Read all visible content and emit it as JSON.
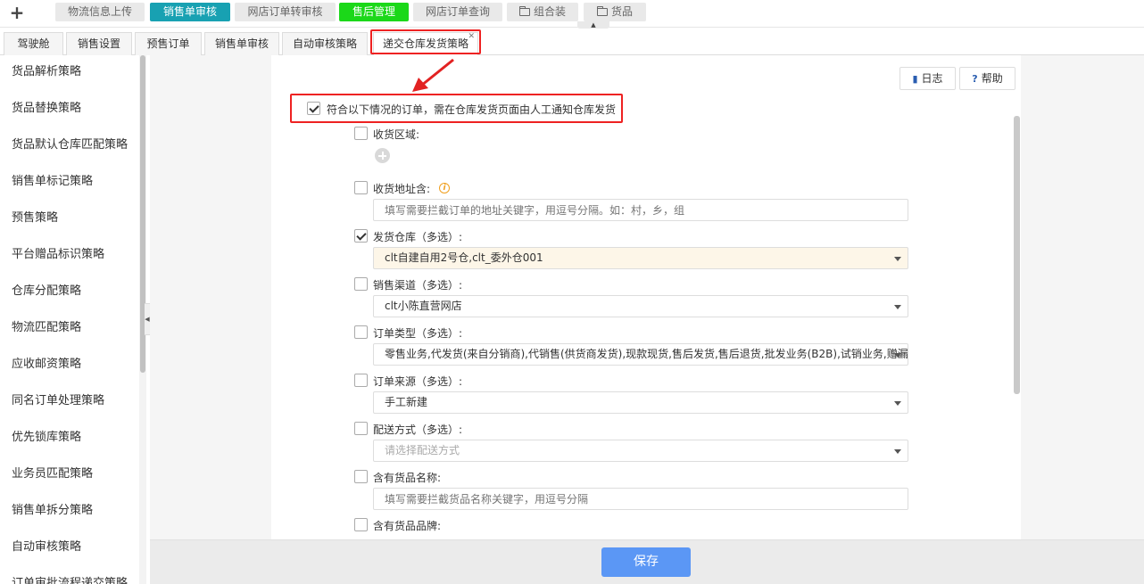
{
  "top_tabs": [
    {
      "label": "物流信息上传"
    },
    {
      "label": "销售单审核"
    },
    {
      "label": "网店订单转审核"
    },
    {
      "label": "售后管理"
    },
    {
      "label": "网店订单查询"
    },
    {
      "label": "组合装"
    },
    {
      "label": "货品"
    }
  ],
  "colors": {
    "active_teal": "#18a1b2",
    "green_tab": "#1bd819",
    "save_blue": "#5b97f5",
    "annotation_red": "#e22222"
  },
  "sub_tabs": [
    {
      "label": "驾驶舱"
    },
    {
      "label": "销售设置"
    },
    {
      "label": "预售订单"
    },
    {
      "label": "销售单审核"
    },
    {
      "label": "自动审核策略"
    },
    {
      "label": "递交仓库发货策略"
    }
  ],
  "sidebar": {
    "items": [
      {
        "label": "货品解析策略"
      },
      {
        "label": "货品替换策略"
      },
      {
        "label": "货品默认仓库匹配策略"
      },
      {
        "label": "销售单标记策略"
      },
      {
        "label": "预售策略"
      },
      {
        "label": "平台赠品标识策略"
      },
      {
        "label": "仓库分配策略"
      },
      {
        "label": "物流匹配策略"
      },
      {
        "label": "应收邮资策略"
      },
      {
        "label": "同名订单处理策略"
      },
      {
        "label": "优先锁库策略"
      },
      {
        "label": "业务员匹配策略"
      },
      {
        "label": "销售单拆分策略"
      },
      {
        "label": "自动审核策略"
      },
      {
        "label": "订单审批流程递交策略"
      }
    ]
  },
  "toolbar": {
    "log_label": "日志",
    "help_label": "帮助"
  },
  "form": {
    "main_label": "符合以下情况的订单，需在仓库发货页面由人工通知仓库发货",
    "region_label": "收货区域:",
    "address_label": "收货地址含:",
    "address_placeholder": "填写需要拦截订单的地址关键字，用逗号分隔。如：村，乡，组",
    "warehouse_label": "发货仓库（多选）:",
    "warehouse_value": "clt自建自用2号仓,clt_委外仓001",
    "channel_label": "销售渠道（多选）:",
    "channel_value": "clt小陈直营网店",
    "order_type_label": "订单类型（多选）:",
    "order_type_value": "零售业务,代发货(来自分销商),代销售(供货商发货),现款现货,售后发货,售后退货,批发业务(B2B),试销业务,赠漏",
    "order_source_label": "订单来源（多选）:",
    "order_source_value": "手工新建",
    "delivery_label": "配送方式（多选）:",
    "delivery_placeholder": "请选择配送方式",
    "goods_name_label": "含有货品名称:",
    "goods_name_placeholder": "填写需要拦截货品名称关键字，用逗号分隔",
    "goods_brand_label": "含有货品品牌:"
  },
  "footer": {
    "save_label": "保存"
  }
}
